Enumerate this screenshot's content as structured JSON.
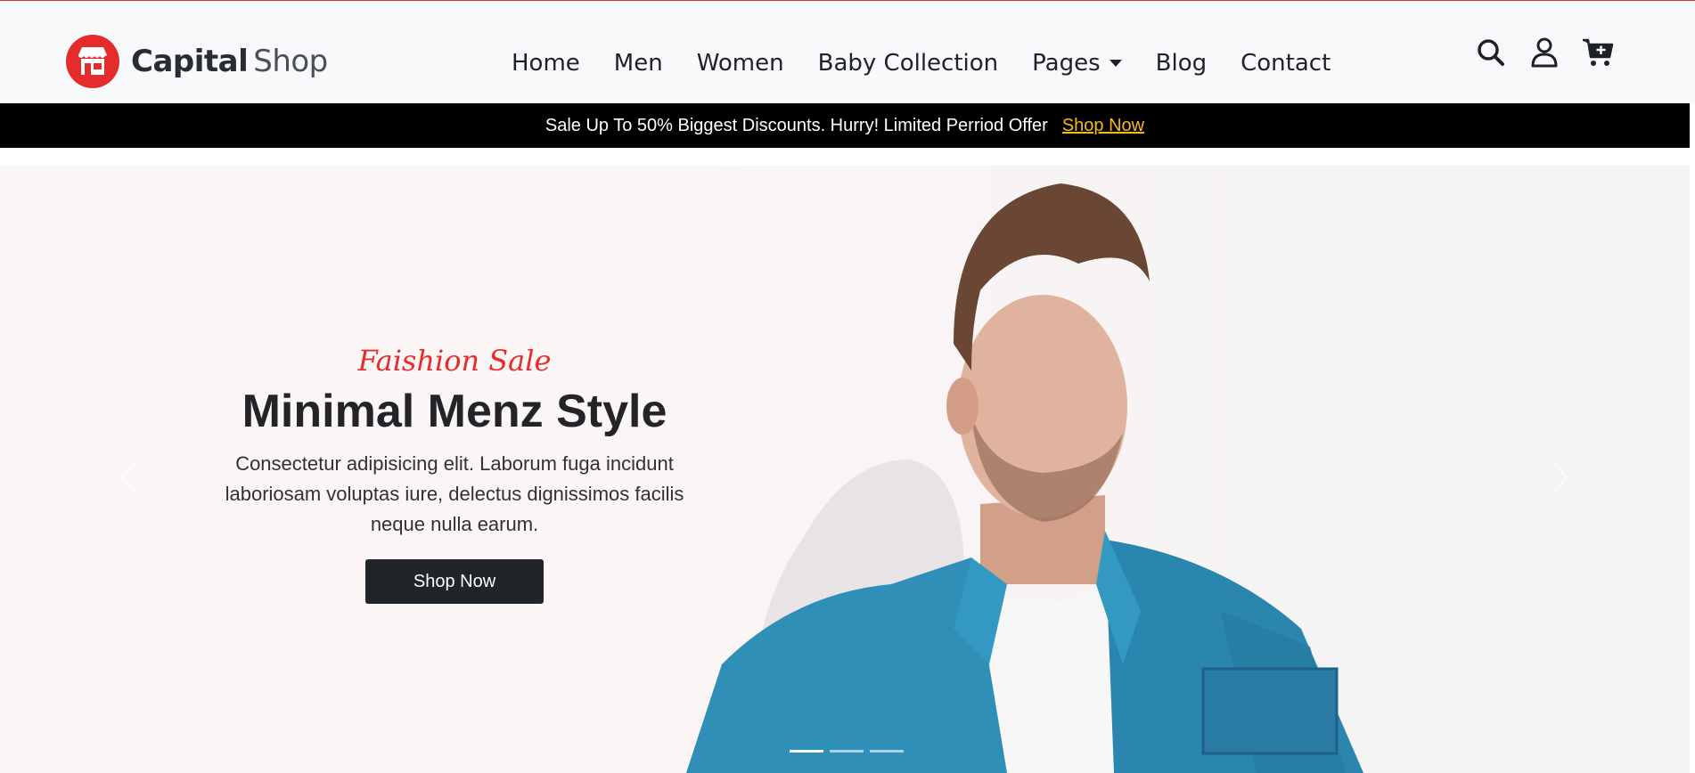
{
  "brand": {
    "bold": "Capital",
    "light": "Shop",
    "icon": "storefront-icon",
    "color": "#e52c2c"
  },
  "nav": {
    "items": [
      {
        "label": "Home"
      },
      {
        "label": "Men"
      },
      {
        "label": "Women"
      },
      {
        "label": "Baby Collection"
      },
      {
        "label": "Pages",
        "dropdown": true
      },
      {
        "label": "Blog"
      },
      {
        "label": "Contact"
      }
    ]
  },
  "header_icons": [
    "search-icon",
    "user-icon",
    "cart-icon"
  ],
  "promo": {
    "text": "Sale Up To 50% Biggest Discounts. Hurry! Limited Perriod Offer",
    "link": "Shop Now",
    "link_color": "#f6b91a"
  },
  "hero": {
    "eyebrow": "Faishion Sale",
    "title": "Minimal Menz Style",
    "description": "Consectetur adipisicing elit. Laborum fuga incidunt laboriosam voluptas iure, delectus dignissimos facilis neque nulla earum.",
    "button": "Shop Now",
    "slides": 3,
    "active_slide": 1
  }
}
